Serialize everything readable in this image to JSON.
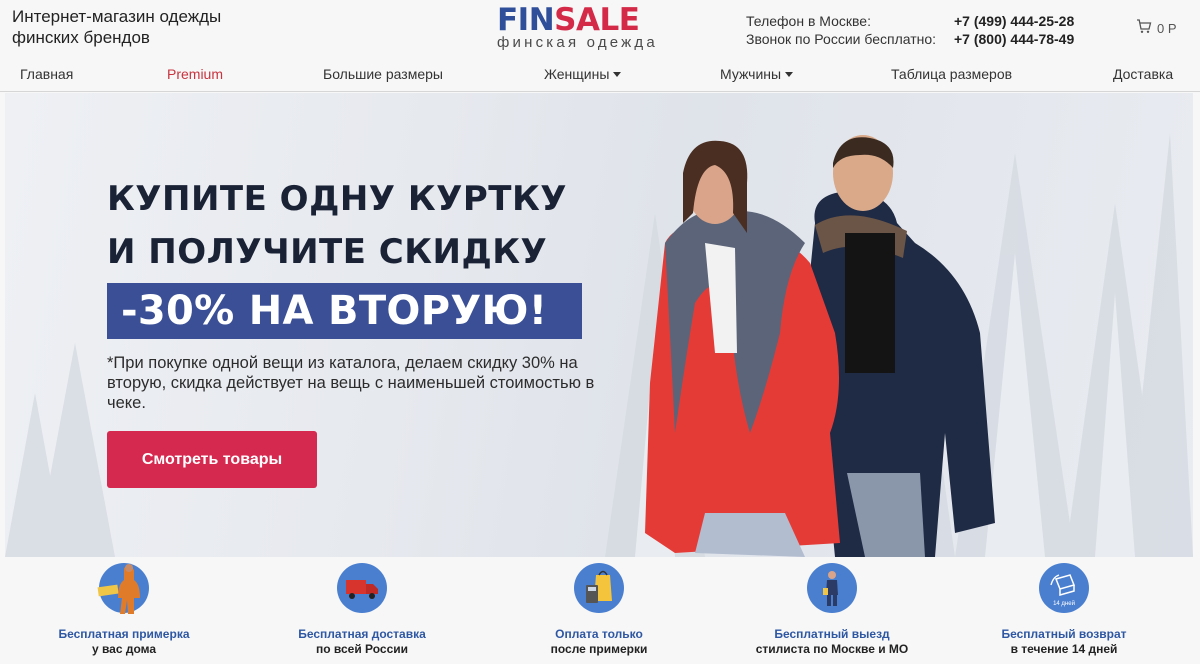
{
  "header": {
    "tagline": "Интернет-магазин одежды финских брендов",
    "logo_main_a": "FIN",
    "logo_main_b": "SALE",
    "logo_sub": "финская одежда",
    "phone_label_1": "Телефон в Москве:",
    "phone_number_1": "+7 (499) 444-25-28",
    "phone_label_2": "Звонок по России бесплатно:",
    "phone_number_2": "+7 (800) 444-78-49",
    "cart_total": "0 Р"
  },
  "nav": {
    "items": [
      {
        "label": "Главная"
      },
      {
        "label": "Premium"
      },
      {
        "label": "Большие размеры"
      },
      {
        "label": "Женщины"
      },
      {
        "label": "Мужчины"
      },
      {
        "label": "Таблица размеров"
      },
      {
        "label": "Доставка"
      }
    ]
  },
  "hero": {
    "title_line1": "КУПИТЕ ОДНУ КУРТКУ",
    "title_line2": "И ПОЛУЧИТЕ СКИДКУ",
    "banner": "-30% НА ВТОРУЮ!",
    "note": "*При покупке одной вещи из каталога, делаем скидку 30% на вторую, скидка действует на вещь с наименьшей стоимостью в чеке.",
    "button": "Смотреть товары"
  },
  "features": [
    {
      "line1": "Бесплатная примерка",
      "line2": "у вас дома",
      "icon": "fitting-icon"
    },
    {
      "line1": "Бесплатная доставка",
      "line2": "по всей России",
      "icon": "truck-icon"
    },
    {
      "line1": "Оплата только",
      "line2": "после примерки",
      "icon": "payment-icon"
    },
    {
      "line1": "Бесплатный выезд",
      "line2": "стилиста по Москве и МО",
      "icon": "stylist-icon"
    },
    {
      "line1": "Бесплатный возврат",
      "line2": "в течение 14 дней",
      "icon": "return-icon",
      "badge": "14 дней"
    }
  ],
  "colors": {
    "brand_blue": "#2f4f9a",
    "brand_red": "#d42a48",
    "banner_blue": "#3a4f96",
    "button_red": "#d6294f",
    "feature_icon_blue": "#4a7fd0"
  }
}
